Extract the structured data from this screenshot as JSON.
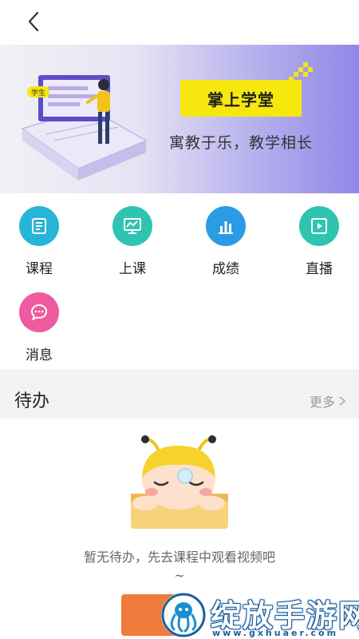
{
  "topbar": {
    "back_icon": "chevron-left-icon"
  },
  "banner": {
    "title": "掌上学堂",
    "slogan": "寓教于乐，教学相长",
    "badge_text": "学生",
    "accent_color": "#f6e70e"
  },
  "menu": {
    "items": [
      {
        "label": "课程",
        "icon": "course-book-icon",
        "color": "#27b5d7"
      },
      {
        "label": "上课",
        "icon": "presentation-board-icon",
        "color": "#2ec4b0"
      },
      {
        "label": "成绩",
        "icon": "bar-chart-icon",
        "color": "#2b9be3"
      },
      {
        "label": "直播",
        "icon": "play-video-icon",
        "color": "#2ec4b0"
      },
      {
        "label": "消息",
        "icon": "chat-bubble-icon",
        "color": "#ee5b9e"
      }
    ]
  },
  "todo": {
    "title": "待办",
    "more_label": "更多",
    "empty_text": "暂无待办，先去课程中观看视频吧~",
    "cta_color": "#f07a3b"
  },
  "watermark": {
    "text": "绽放手游网",
    "url": "www.gxhuaer.com"
  }
}
